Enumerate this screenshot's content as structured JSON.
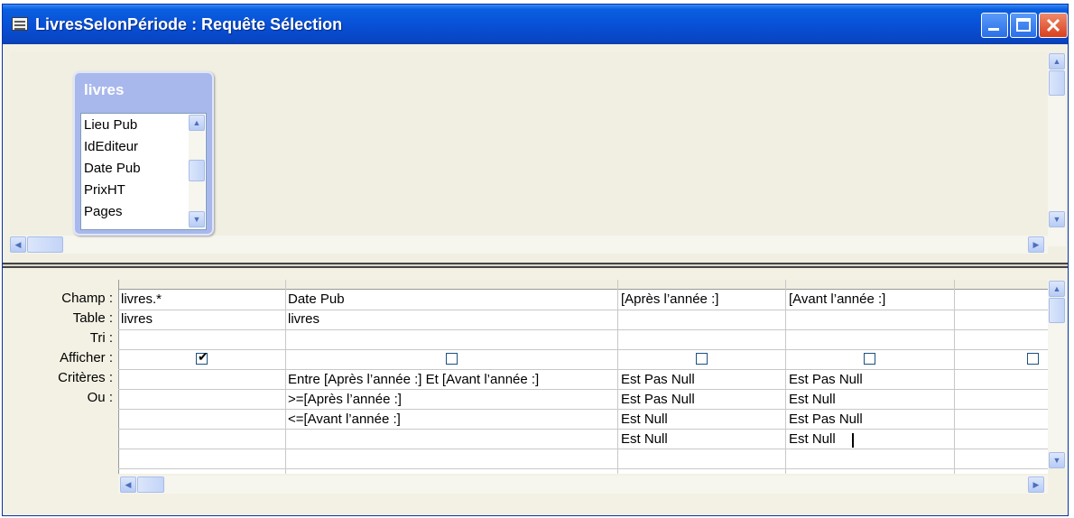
{
  "window": {
    "title": "LivresSelonPériode : Requête Sélection"
  },
  "table_box": {
    "name": "livres",
    "fields": [
      "Lieu Pub",
      "IdEditeur",
      "Date Pub",
      "PrixHT",
      "Pages"
    ]
  },
  "grid": {
    "row_labels": [
      "Champ :",
      "Table :",
      "Tri :",
      "Afficher :",
      "Critères :",
      "Ou :"
    ],
    "columns": [
      {
        "champ": "livres.*",
        "table": "livres",
        "tri": "",
        "afficher": true,
        "criteres": "",
        "ou": [
          "",
          "",
          ""
        ]
      },
      {
        "champ": "Date Pub",
        "table": "livres",
        "tri": "",
        "afficher": false,
        "criteres": "Entre [Après l’année :] Et [Avant l’année :]",
        "ou": [
          ">=[Après l’année :]",
          "<=[Avant l’année :]",
          ""
        ]
      },
      {
        "champ": "[Après l’année :]",
        "table": "",
        "tri": "",
        "afficher": false,
        "criteres": "Est Pas Null",
        "ou": [
          "Est Pas Null",
          "Est Null",
          "Est Null"
        ]
      },
      {
        "champ": "[Avant l’année :]",
        "table": "",
        "tri": "",
        "afficher": false,
        "criteres": "Est Pas Null",
        "ou": [
          "Est Null",
          "Est Pas Null",
          "Est Null"
        ]
      },
      {
        "champ": "",
        "table": "",
        "tri": "",
        "afficher": false,
        "criteres": "",
        "ou": [
          "",
          "",
          ""
        ]
      }
    ]
  },
  "icons": {
    "minimize": "minimize-icon",
    "maximize": "maximize-icon",
    "close": "close-icon",
    "scroll_up": "scroll-up-icon",
    "scroll_down": "scroll-down-icon",
    "scroll_left": "scroll-left-icon",
    "scroll_right": "scroll-right-icon"
  }
}
